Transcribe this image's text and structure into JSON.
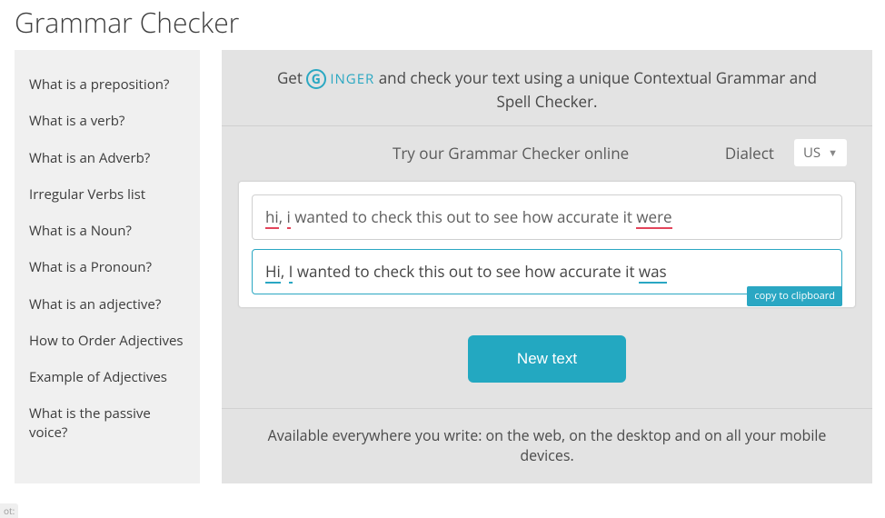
{
  "title": "Grammar Checker",
  "sidebar": {
    "items": [
      {
        "label": "What is a preposition?"
      },
      {
        "label": "What is a verb?"
      },
      {
        "label": "What is an Adverb?"
      },
      {
        "label": "Irregular Verbs list"
      },
      {
        "label": "What is a Noun?"
      },
      {
        "label": "What is a Pronoun?"
      },
      {
        "label": "What is an adjective?"
      },
      {
        "label": "How to Order Adjectives"
      },
      {
        "label": "Example of Adjectives"
      },
      {
        "label": "What is the passive voice?"
      }
    ]
  },
  "promo": {
    "prefix": "Get ",
    "brand": "INGER",
    "suffix": " and check your text using a unique Contextual Grammar and Spell Checker."
  },
  "toolbar": {
    "try_label": "Try our Grammar Checker online",
    "dialect_label": "Dialect",
    "dialect_value": "US"
  },
  "checker": {
    "input": {
      "segments": [
        {
          "text": "hi",
          "err": true
        },
        {
          "text": ", ",
          "err": false
        },
        {
          "text": "i",
          "err": true
        },
        {
          "text": " wanted to check this out to see how accurate it ",
          "err": false
        },
        {
          "text": "were",
          "err": true
        }
      ]
    },
    "output": {
      "segments": [
        {
          "text": "Hi",
          "fix": true
        },
        {
          "text": ", ",
          "fix": false
        },
        {
          "text": "I",
          "fix": true
        },
        {
          "text": " wanted to check this out to see how accurate it ",
          "fix": false
        },
        {
          "text": "was",
          "fix": true
        }
      ]
    },
    "copy_label": "copy to clipboard",
    "new_text_label": "New text"
  },
  "footnote": "Available everywhere you write: on the web, on the desktop and on all your mobile devices.",
  "corner_tag": "ot:"
}
